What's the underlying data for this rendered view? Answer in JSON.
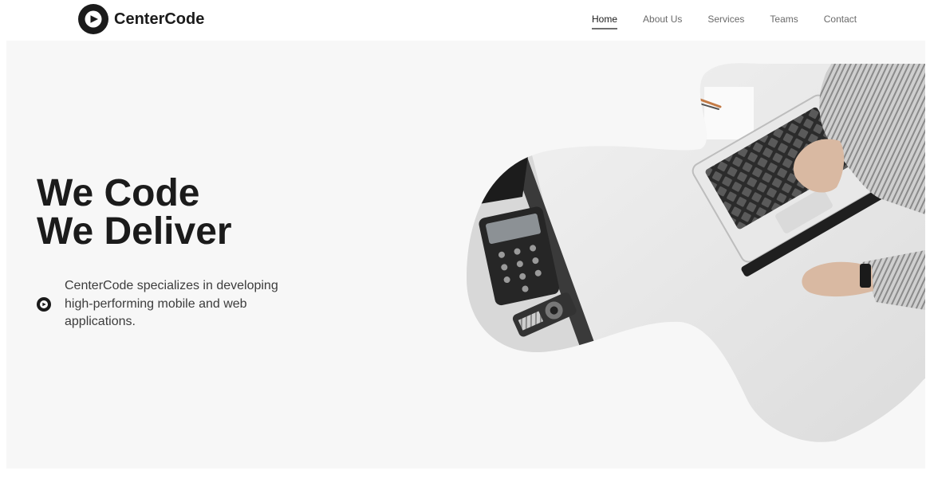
{
  "brand": {
    "name": "CenterCode",
    "logo_icon": "play-circle-icon",
    "color": "#1b1b1b"
  },
  "nav": {
    "items": [
      {
        "label": "Home",
        "active": true
      },
      {
        "label": "About Us",
        "active": false
      },
      {
        "label": "Services",
        "active": false
      },
      {
        "label": "Teams",
        "active": false
      },
      {
        "label": "Contact",
        "active": false
      }
    ]
  },
  "hero": {
    "headline_line1": "We Code",
    "headline_line2": "We Deliver",
    "description": "CenterCode specializes in developing high-performing mobile and web applications.",
    "description_icon": "play-circle-icon",
    "image_icon": "laptop-workspace-photo",
    "background": "#f7f7f7"
  }
}
